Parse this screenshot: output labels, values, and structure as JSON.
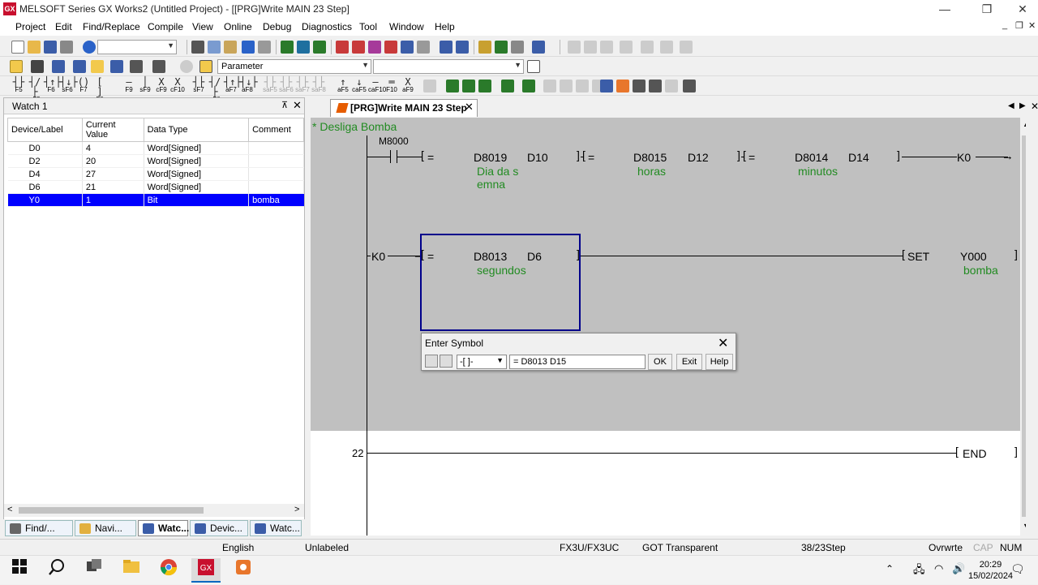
{
  "window": {
    "title": "MELSOFT Series GX Works2 (Untitled Project) - [[PRG]Write MAIN 23 Step]",
    "app_icon": "GX",
    "min": "—",
    "max": "❐",
    "close": "✕"
  },
  "menu": {
    "items": [
      "Project",
      "Edit",
      "Find/Replace",
      "Compile",
      "View",
      "Online",
      "Debug",
      "Diagnostics",
      "Tool",
      "Window",
      "Help"
    ],
    "mdi_min": "_",
    "mdi_restore": "❐",
    "mdi_close": "✕"
  },
  "toolbar2": {
    "param_combo": "Parameter"
  },
  "fkeys": [
    {
      "glyph": "┤├",
      "label": "F5"
    },
    {
      "glyph": "┤/├",
      "label": "sF5"
    },
    {
      "glyph": "┤↑├",
      "label": "F6"
    },
    {
      "glyph": "┤↓├",
      "label": "sF6"
    },
    {
      "glyph": "()",
      "label": "F7"
    },
    {
      "glyph": "[ ]",
      "label": "F8"
    },
    {
      "glyph": "—",
      "label": "F9"
    },
    {
      "glyph": "│",
      "label": "sF9"
    },
    {
      "glyph": "X",
      "label": "cF9"
    },
    {
      "glyph": "X",
      "label": "cF10"
    },
    {
      "glyph": "┤├",
      "label": "sF7"
    },
    {
      "glyph": "┤/├",
      "label": "sF8"
    },
    {
      "glyph": "┤↑├",
      "label": "aF7"
    },
    {
      "glyph": "┤↓├",
      "label": "aF8"
    },
    {
      "glyph": "┤├",
      "label": "saF5"
    },
    {
      "glyph": "┤├",
      "label": "saF6"
    },
    {
      "glyph": "┤├",
      "label": "saF7"
    },
    {
      "glyph": "┤├",
      "label": "saF8"
    },
    {
      "glyph": "↑",
      "label": "aF5"
    },
    {
      "glyph": "↓",
      "label": "caF5"
    },
    {
      "glyph": "—",
      "label": "caF10"
    },
    {
      "glyph": "═",
      "label": "F10"
    },
    {
      "glyph": "X",
      "label": "aF9"
    }
  ],
  "watch": {
    "title": "Watch 1",
    "pin": "⊼",
    "close": "✕",
    "columns": [
      "Device/Label",
      "Current Value",
      "Data Type",
      "Comment"
    ],
    "rows": [
      {
        "device": "D0",
        "value": "4",
        "type": "Word[Signed]",
        "comment": ""
      },
      {
        "device": "D2",
        "value": "20",
        "type": "Word[Signed]",
        "comment": ""
      },
      {
        "device": "D4",
        "value": "27",
        "type": "Word[Signed]",
        "comment": ""
      },
      {
        "device": "D6",
        "value": "21",
        "type": "Word[Signed]",
        "comment": ""
      },
      {
        "device": "Y0",
        "value": "1",
        "type": "Bit",
        "comment": "bomba"
      }
    ],
    "scroll_left": "<",
    "scroll_right": ">"
  },
  "bottom_tabs": [
    "Find/...",
    "Navi...",
    "Watc...",
    "Devic...",
    "Watc..."
  ],
  "editor": {
    "tab_label": "[PRG]Write MAIN 23 Step",
    "tab_close": "✕",
    "nav_left": "◀",
    "nav_right": "▶",
    "nav_close": "✕"
  },
  "ladder": {
    "comment": "* Desliga Bomba",
    "rung1": {
      "contact": "M8000",
      "cmp1_op": "=",
      "cmp1_a": "D8019",
      "cmp1_b": "D10",
      "cmp1_comment": "Dia da s",
      "cmp1_comment2": "emna",
      "cmp2_op": "=",
      "cmp2_a": "D8015",
      "cmp2_b": "D12",
      "cmp2_comment": "horas",
      "cmp3_op": "=",
      "cmp3_a": "D8014",
      "cmp3_b": "D14",
      "cmp3_comment": "minutos",
      "out": "K0"
    },
    "rung2": {
      "in": "K0",
      "cmp_op": "=",
      "cmp_a": "D8013",
      "cmp_b": "D6",
      "cmp_comment": "segundos",
      "instr": "SET",
      "dev": "Y000",
      "dev_comment": "bomba"
    },
    "rung3": {
      "step": "22",
      "instr": "END"
    }
  },
  "dialog": {
    "title": "Enter Symbol",
    "type": "-[ ]-",
    "input": "= D8013 D15",
    "ok": "OK",
    "exit": "Exit",
    "help": "Help",
    "close": "✕"
  },
  "status": {
    "lang": "English",
    "label": "Unlabeled",
    "cpu": "FX3U/FX3UC",
    "conn": "GOT Transparent",
    "steps": "38/23Step",
    "mode": "Ovrwrte",
    "cap": "CAP",
    "num": "NUM"
  },
  "taskbar": {
    "time": "20:29",
    "date": "15/02/2024"
  }
}
